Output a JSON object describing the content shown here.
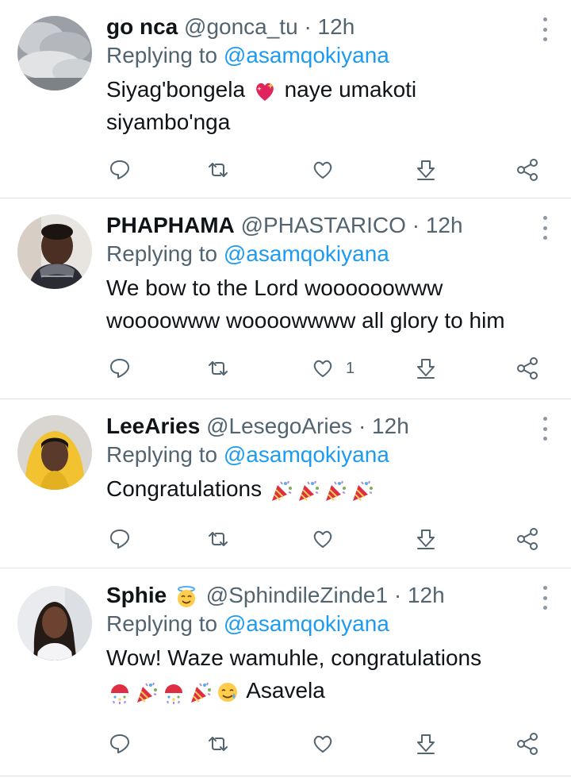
{
  "tweets": [
    {
      "name": "go nca",
      "handle": "@gonca_tu",
      "time": "12h",
      "replying_prefix": "Replying to",
      "replying_to": "@asamqokiyana",
      "lines": [
        "Siyag'bongela",
        "naye umakoti",
        "siyambo'nga"
      ],
      "avatar": "cloudy-sky-avatar",
      "like_count": ""
    },
    {
      "name": "PHAPHAMA",
      "handle": "@PHASTARICO",
      "time": "12h",
      "replying_prefix": "Replying to",
      "replying_to": "@asamqokiyana",
      "lines": [
        "We bow to the Lord woooooowww",
        "woooowww woooowwww all glory to him"
      ],
      "avatar": "man-in-scarf-avatar",
      "like_count": "1"
    },
    {
      "name": "LeeAries",
      "handle": "@LesegoAries",
      "time": "12h",
      "replying_prefix": "Replying to",
      "replying_to": "@asamqokiyana",
      "lines": [
        "Congratulations"
      ],
      "avatar": "woman-yellow-hoodie-avatar",
      "like_count": ""
    },
    {
      "name": "Sphie",
      "handle": "@SphindileZinde1",
      "time": "12h",
      "replying_prefix": "Replying to",
      "replying_to": "@asamqokiyana",
      "lines": [
        "Wow! Waze wamuhle, congratulations",
        "Asavela"
      ],
      "avatar": "woman-portrait-avatar",
      "like_count": ""
    }
  ],
  "separator": "·",
  "colors": {
    "link": "#1d9bf0",
    "muted": "#536471",
    "text": "#0f1419",
    "divider": "#dfe3e6"
  },
  "icons": [
    "reply-icon",
    "retweet-icon",
    "like-icon",
    "download-icon",
    "share-icon",
    "more-icon",
    "sparkling-heart-emoji",
    "party-popper-emoji",
    "confetti-ball-emoji",
    "smiling-face-with-halo-emoji",
    "face-with-tear-emoji"
  ]
}
